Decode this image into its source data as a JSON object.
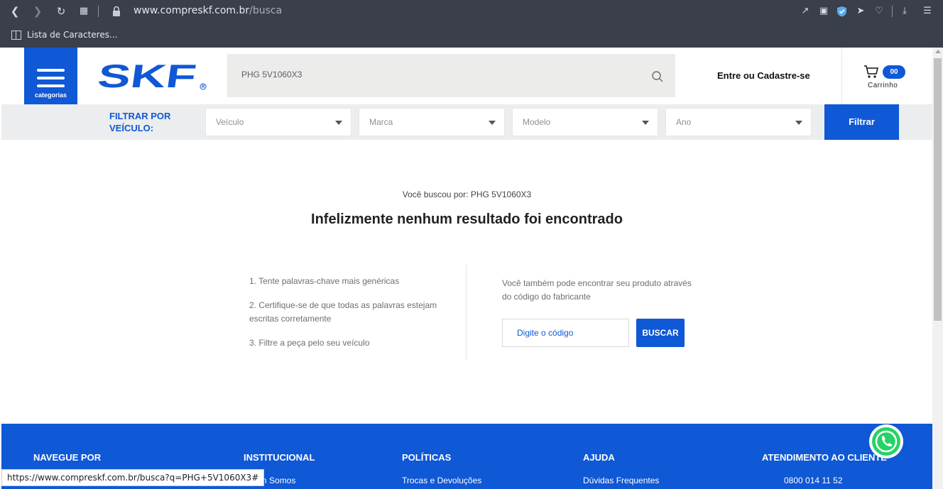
{
  "browser": {
    "url_host": "www.compreskf.com.br",
    "url_path": "/busca",
    "bookmark": "Lista de Caracteres..."
  },
  "header": {
    "categories_label": "categorias",
    "logo_text": "SKF",
    "search_value": "PHG 5V1060X3",
    "login_label": "Entre ou Cadastre-se",
    "cart_count": "00",
    "cart_label": "Carrinho"
  },
  "filter": {
    "title": "FILTRAR POR VEÍCULO:",
    "selects": [
      "Veículo",
      "Marca",
      "Modelo",
      "Ano"
    ],
    "button_label": "Filtrar"
  },
  "results": {
    "searched_for": "Você buscou por: PHG 5V1060X3",
    "no_results": "Infelizmente nenhum resultado foi encontrado",
    "tips": [
      "1. Tente palavras-chave mais genéricas",
      "2. Certifique-se de que todas as palavras estejam escritas corretamente",
      "3. Filtre a peça pelo seu veículo"
    ],
    "alt_text": "Você também pode encontrar seu produto através do código do fabricante",
    "code_placeholder": "Digite o código",
    "buscar_label": "BUSCAR"
  },
  "footer": {
    "columns": [
      {
        "heading": "NAVEGUE POR",
        "link": ""
      },
      {
        "heading": "INSTITUCIONAL",
        "link": "Quem Somos"
      },
      {
        "heading": "POLÍTICAS",
        "link": "Trocas e Devoluções"
      },
      {
        "heading": "AJUDA",
        "link": "Dúvidas Frequentes"
      },
      {
        "heading": "ATENDIMENTO AO CLIENTE",
        "link": "0800 014 11 52"
      }
    ]
  },
  "status_url": "https://www.compreskf.com.br/busca?q=PHG+5V1060X3#",
  "colors": {
    "brand_blue": "#0f58d6",
    "chrome": "#3a3f4b",
    "whatsapp_green": "#25d366"
  }
}
